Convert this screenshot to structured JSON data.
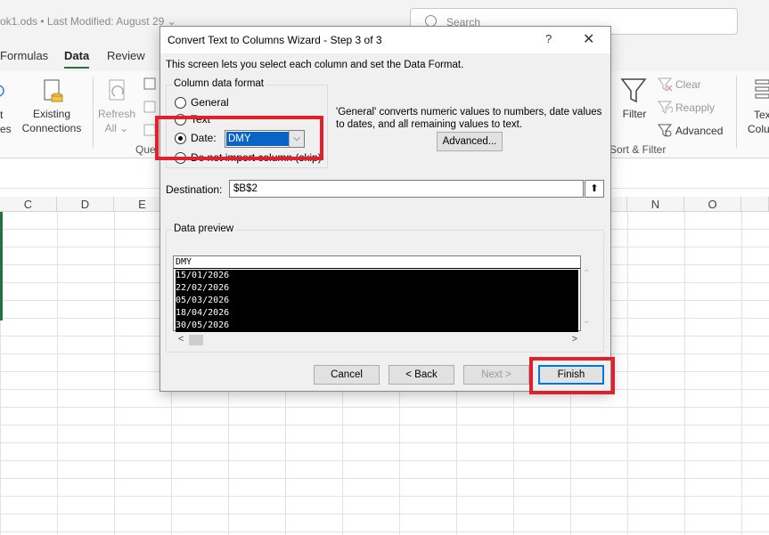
{
  "excel": {
    "doc_title": "ok1.ods • Last Modified: August 29 ⌄",
    "search_placeholder": "Search",
    "tabs": [
      {
        "label": "Formulas"
      },
      {
        "label": "Data"
      },
      {
        "label": "Review"
      }
    ],
    "ribbon": {
      "left_partial": [
        "t",
        "es"
      ],
      "existing_connections": [
        "Existing",
        "Connections"
      ],
      "refresh_all": [
        "Refresh",
        "All ⌄"
      ],
      "queries_partial": "Que",
      "filter": "Filter",
      "clear": "Clear",
      "reapply": "Reapply",
      "advanced": "Advanced",
      "sort_filter_label": "Sort & Filter",
      "text_to_columns_partial": [
        "Tex",
        "Colu"
      ]
    },
    "columns": [
      "C",
      "D",
      "E",
      "N",
      "O"
    ]
  },
  "dialog": {
    "title": "Convert Text to Columns Wizard - Step 3 of 3",
    "help_glyph": "?",
    "close_glyph": "✕",
    "intro": "This screen lets you select each column and set the Data Format.",
    "column_format_legend": "Column data format",
    "options": [
      {
        "label": "General",
        "selected": false
      },
      {
        "label": "Text",
        "selected": false
      },
      {
        "label": "Date:",
        "selected": true
      },
      {
        "label": "Do not import column (skip)",
        "selected": false
      }
    ],
    "date_format": "DMY",
    "help_text": "'General' converts numeric values to numbers, date values to dates, and all remaining values to text.",
    "advanced_button": "Advanced...",
    "destination_label": "Destination:",
    "destination_value": "$B$2",
    "collapse_glyph": "⬆",
    "preview_label": "Data preview",
    "preview_header": "DMY",
    "preview_rows": [
      "15/01/2026",
      "22/02/2026",
      "05/03/2026",
      "18/04/2026",
      "30/05/2026"
    ],
    "buttons": {
      "cancel": "Cancel",
      "back": "< Back",
      "next": "Next >",
      "finish": "Finish"
    }
  },
  "colors": {
    "highlight": "#e0202a",
    "accent": "#217346",
    "selection": "#0a64c8"
  }
}
